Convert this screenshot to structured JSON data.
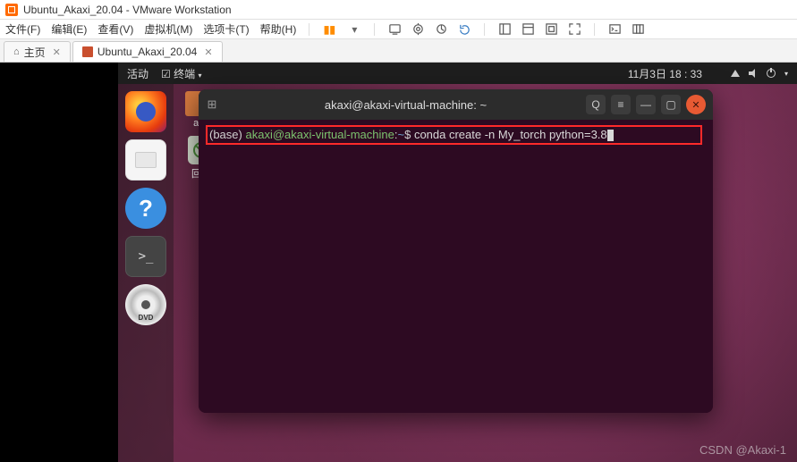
{
  "vmware": {
    "title": "Ubuntu_Akaxi_20.04 - VMware Workstation",
    "menu": {
      "file": "文件(F)",
      "edit": "编辑(E)",
      "view": "查看(V)",
      "vm": "虚拟机(M)",
      "tabs": "选项卡(T)",
      "help": "帮助(H)"
    },
    "tabs": {
      "home": "主页",
      "vm_tab": "Ubuntu_Akaxi_20.04"
    }
  },
  "ubuntu": {
    "topbar": {
      "activities": "活动",
      "terminal_menu": "终端",
      "datetime": "11月3日 18 : 33"
    },
    "desktop": {
      "folder_label": "aka",
      "trash_label": "回收"
    },
    "terminal": {
      "title": "akaxi@akaxi-virtual-machine: ~",
      "prompt_base": "(base)",
      "prompt_user": "akaxi@akaxi-virtual-machine",
      "prompt_sep": ":",
      "prompt_path": "~",
      "prompt_dollar": "$",
      "command": "conda create -n My_torch python=3.8"
    }
  },
  "watermark": "CSDN @Akaxi-1"
}
